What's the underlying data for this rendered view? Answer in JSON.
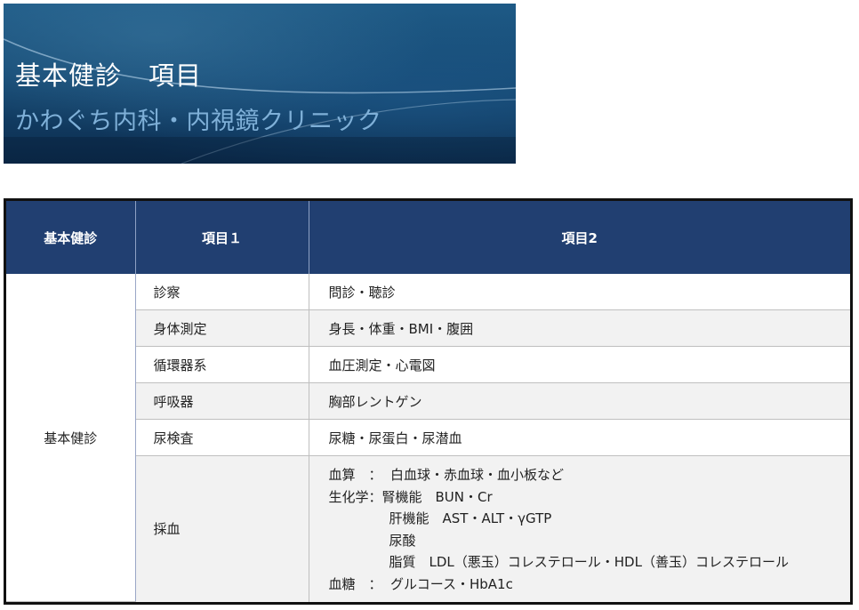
{
  "banner": {
    "title": "基本健診　項目",
    "subtitle": "かわぐち内科・内視鏡クリニック"
  },
  "table": {
    "headers": [
      "基本健診",
      "項目１",
      "項目2"
    ],
    "category": "基本健診",
    "rows": [
      {
        "item1": "診察",
        "item2": "問診・聴診"
      },
      {
        "item1": "身体測定",
        "item2": "身長・体重・BMI・腹囲"
      },
      {
        "item1": "循環器系",
        "item2": "血圧測定・心電図"
      },
      {
        "item1": "呼吸器",
        "item2": "胸部レントゲン"
      },
      {
        "item1": "尿検査",
        "item2": "尿糖・尿蛋白・尿潜血"
      }
    ],
    "blood": {
      "item1": "採血",
      "lines": [
        "血算　：  白血球・赤血球・血小板など",
        "生化学：腎機能　BUN・Cr",
        "肝機能　AST・ALT・γGTP",
        "尿酸",
        "脂質　LDL（悪玉）コレステロール・HDL（善玉）コレステロール",
        "血糖　：  グルコース・HbA1c"
      ]
    }
  }
}
